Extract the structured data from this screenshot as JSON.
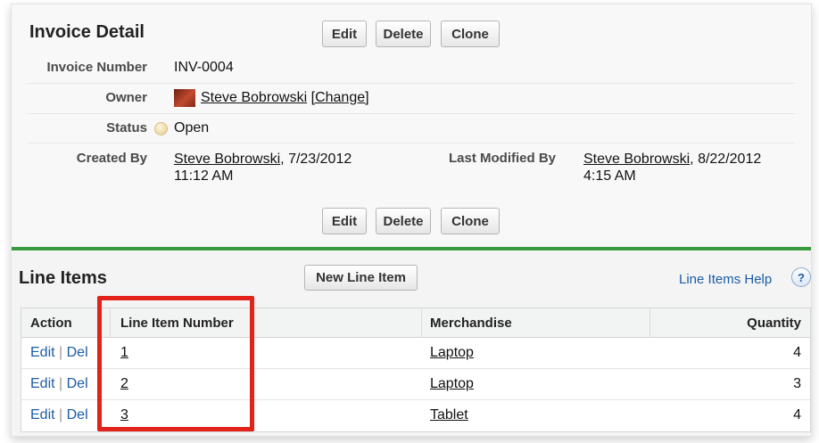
{
  "detail": {
    "title": "Invoice Detail",
    "buttons": {
      "edit": "Edit",
      "delete": "Delete",
      "clone": "Clone"
    },
    "fields": {
      "invoice_number_label": "Invoice Number",
      "invoice_number": "INV-0004",
      "owner_label": "Owner",
      "owner_name": "Steve Bobrowski",
      "owner_change": "[Change]",
      "status_label": "Status",
      "status": "Open",
      "created_by_label": "Created By",
      "created_by_name": "Steve Bobrowski",
      "created_by_date": ", 7/23/2012",
      "created_by_time": "11:12 AM",
      "modified_by_label": "Last Modified By",
      "modified_by_name": "Steve Bobrowski",
      "modified_by_date": ", 8/22/2012",
      "modified_by_time": "4:15 AM"
    }
  },
  "line_items": {
    "title": "Line Items",
    "new_button": "New Line Item",
    "help_link": "Line Items Help",
    "help_icon": "?",
    "columns": [
      "Action",
      "Line Item Number",
      "Merchandise",
      "Quantity"
    ],
    "action_edit": "Edit",
    "action_sep": " | ",
    "action_del": "Del",
    "rows": [
      {
        "number": "1",
        "merchandise": "Laptop",
        "quantity": "4"
      },
      {
        "number": "2",
        "merchandise": "Laptop",
        "quantity": "3"
      },
      {
        "number": "3",
        "merchandise": "Tablet",
        "quantity": "4"
      }
    ]
  },
  "colors": {
    "accent_green": "#3a9b3e",
    "link_blue": "#1a5ca8",
    "highlight_red": "#e2231a"
  },
  "icons": {
    "status": "status-circle-icon",
    "avatar": "avatar",
    "help": "help-icon"
  }
}
